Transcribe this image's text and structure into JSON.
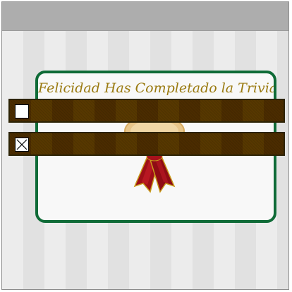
{
  "dialog": {
    "title": "Felicidad Has Completado la Trivia"
  },
  "options": [
    {
      "checked": false
    },
    {
      "checked": true
    }
  ],
  "colors": {
    "card_border": "#0f6b37",
    "title_text": "#9a7a10",
    "bar_gold": "#8a6a00",
    "ribbon_red": "#a8121b"
  },
  "icons": {
    "award": "award-ribbon-icon",
    "unchecked": "checkbox-empty-icon",
    "checked": "checkbox-x-icon"
  }
}
